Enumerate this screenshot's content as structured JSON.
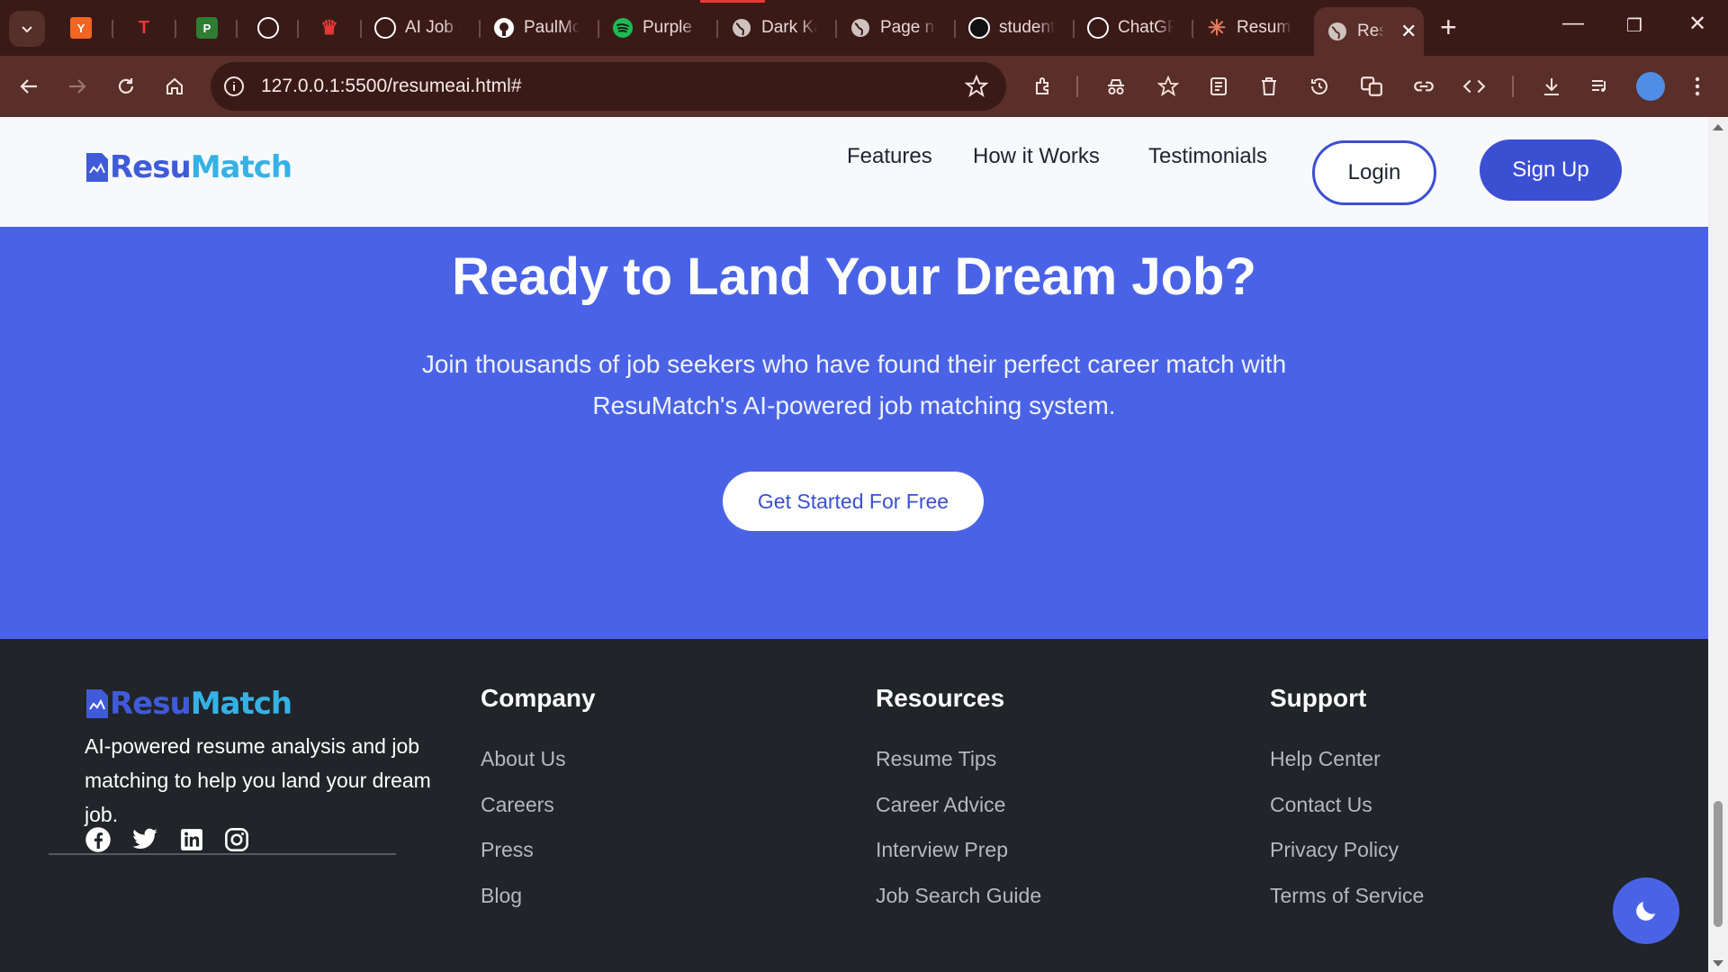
{
  "browser": {
    "tabs": [
      {
        "title": "",
        "icon": "y-combinator-icon",
        "color": "#f26522",
        "glyph": "Y"
      },
      {
        "title": "",
        "icon": "tj-icon",
        "color": "#c62828",
        "glyph": "T"
      },
      {
        "title": "",
        "icon": "p-logo-icon",
        "color": "#2e7d32",
        "glyph": "P"
      },
      {
        "title": "",
        "icon": "chatgpt-icon",
        "color": "#ffffff",
        "glyph": ""
      },
      {
        "title": "",
        "icon": "crown-icon",
        "color": "#e53935",
        "glyph": "♛"
      },
      {
        "title": "AI Job M",
        "icon": "chatgpt-icon",
        "color": "#ffffff",
        "glyph": ""
      },
      {
        "title": "PaulMcl",
        "icon": "github-icon",
        "color": "#ffffff",
        "glyph": ""
      },
      {
        "title": "Purple I",
        "icon": "spotify-icon",
        "color": "#1db954",
        "glyph": ""
      },
      {
        "title": "Dark Ka",
        "icon": "globe-icon",
        "color": "#cfc2bf",
        "glyph": ""
      },
      {
        "title": "Page no",
        "icon": "globe-icon",
        "color": "#cfc2bf",
        "glyph": ""
      },
      {
        "title": "student",
        "icon": "student-icon",
        "color": "#111111",
        "glyph": ""
      },
      {
        "title": "ChatGP",
        "icon": "chatgpt-icon",
        "color": "#ffffff",
        "glyph": ""
      },
      {
        "title": "Resume",
        "icon": "claude-icon",
        "color": "#e07a5f",
        "glyph": "✳"
      },
      {
        "title": "Res",
        "icon": "globe-icon",
        "color": "#cfc2bf",
        "glyph": "",
        "active": true
      }
    ],
    "url": "127.0.0.1:5500/resumeai.html#"
  },
  "site": {
    "logo": {
      "part1": "Resu",
      "part2": "Match"
    },
    "nav": {
      "features": "Features",
      "how_it_works": "How it Works",
      "testimonials": "Testimonials",
      "login": "Login",
      "signup": "Sign Up"
    },
    "cta": {
      "title": "Ready to Land Your Dream Job?",
      "text": "Join thousands of job seekers who have found their perfect career match with ResuMatch's AI-powered job matching system.",
      "button": "Get Started For Free"
    },
    "footer": {
      "description": "AI-powered resume analysis and job matching to help you land your dream job.",
      "social": [
        "facebook-icon",
        "twitter-icon",
        "linkedin-icon",
        "instagram-icon"
      ],
      "company": {
        "title": "Company",
        "links": [
          "About Us",
          "Careers",
          "Press",
          "Blog"
        ]
      },
      "resources": {
        "title": "Resources",
        "links": [
          "Resume Tips",
          "Career Advice",
          "Interview Prep",
          "Job Search Guide"
        ]
      },
      "support": {
        "title": "Support",
        "links": [
          "Help Center",
          "Contact Us",
          "Privacy Policy",
          "Terms of Service"
        ]
      }
    }
  },
  "colors": {
    "brand": "#4a63e6",
    "footer": "#212428",
    "chrome": "#5a2e29"
  }
}
